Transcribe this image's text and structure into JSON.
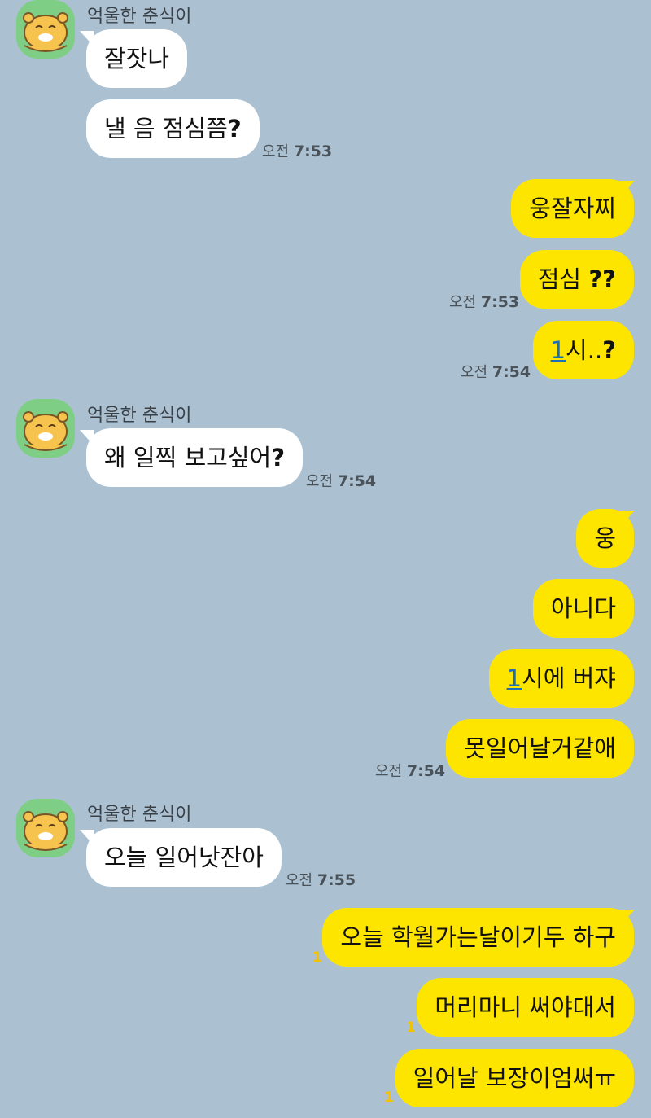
{
  "sender_name": "억울한 춘식이",
  "messages": {
    "m1": {
      "text": "잘잣나"
    },
    "m2": {
      "text": "낼 음 점심쯤",
      "suffix": "?",
      "ampm": "오전",
      "time": "7:53"
    },
    "m3": {
      "text": "웅잘자찌"
    },
    "m4": {
      "text": "점심 ",
      "suffix": "??",
      "ampm": "오전",
      "time": "7:53"
    },
    "m5": {
      "num": "1",
      "text": "시..",
      "suffix": "?",
      "ampm": "오전",
      "time": "7:54"
    },
    "m6": {
      "text": "왜 일찍 보고싶어",
      "suffix": "?",
      "ampm": "오전",
      "time": "7:54"
    },
    "m7": {
      "text": "웅"
    },
    "m8": {
      "text": "아니다"
    },
    "m9": {
      "num": "1",
      "text": "시에 버쟈"
    },
    "m10": {
      "text": "못일어날거같애",
      "ampm": "오전",
      "time": "7:54"
    },
    "m11": {
      "text": "오늘 일어낫잔아",
      "ampm": "오전",
      "time": "7:55"
    },
    "m12": {
      "text": "오늘 학월가는날이기두 하구",
      "unread": "1"
    },
    "m13": {
      "text": "머리마니 써야대서",
      "unread": "1"
    },
    "m14": {
      "text": "일어날 보장이엄써ㅠ",
      "unread": "1"
    }
  },
  "colors": {
    "background": "#abc1d1",
    "outgoing_bubble": "#fee500",
    "incoming_bubble": "#ffffff",
    "avatar_bg": "#7fce86",
    "unread_count": "#f2c200"
  },
  "icons": {
    "avatar": "chunsik-character-avatar-icon"
  }
}
